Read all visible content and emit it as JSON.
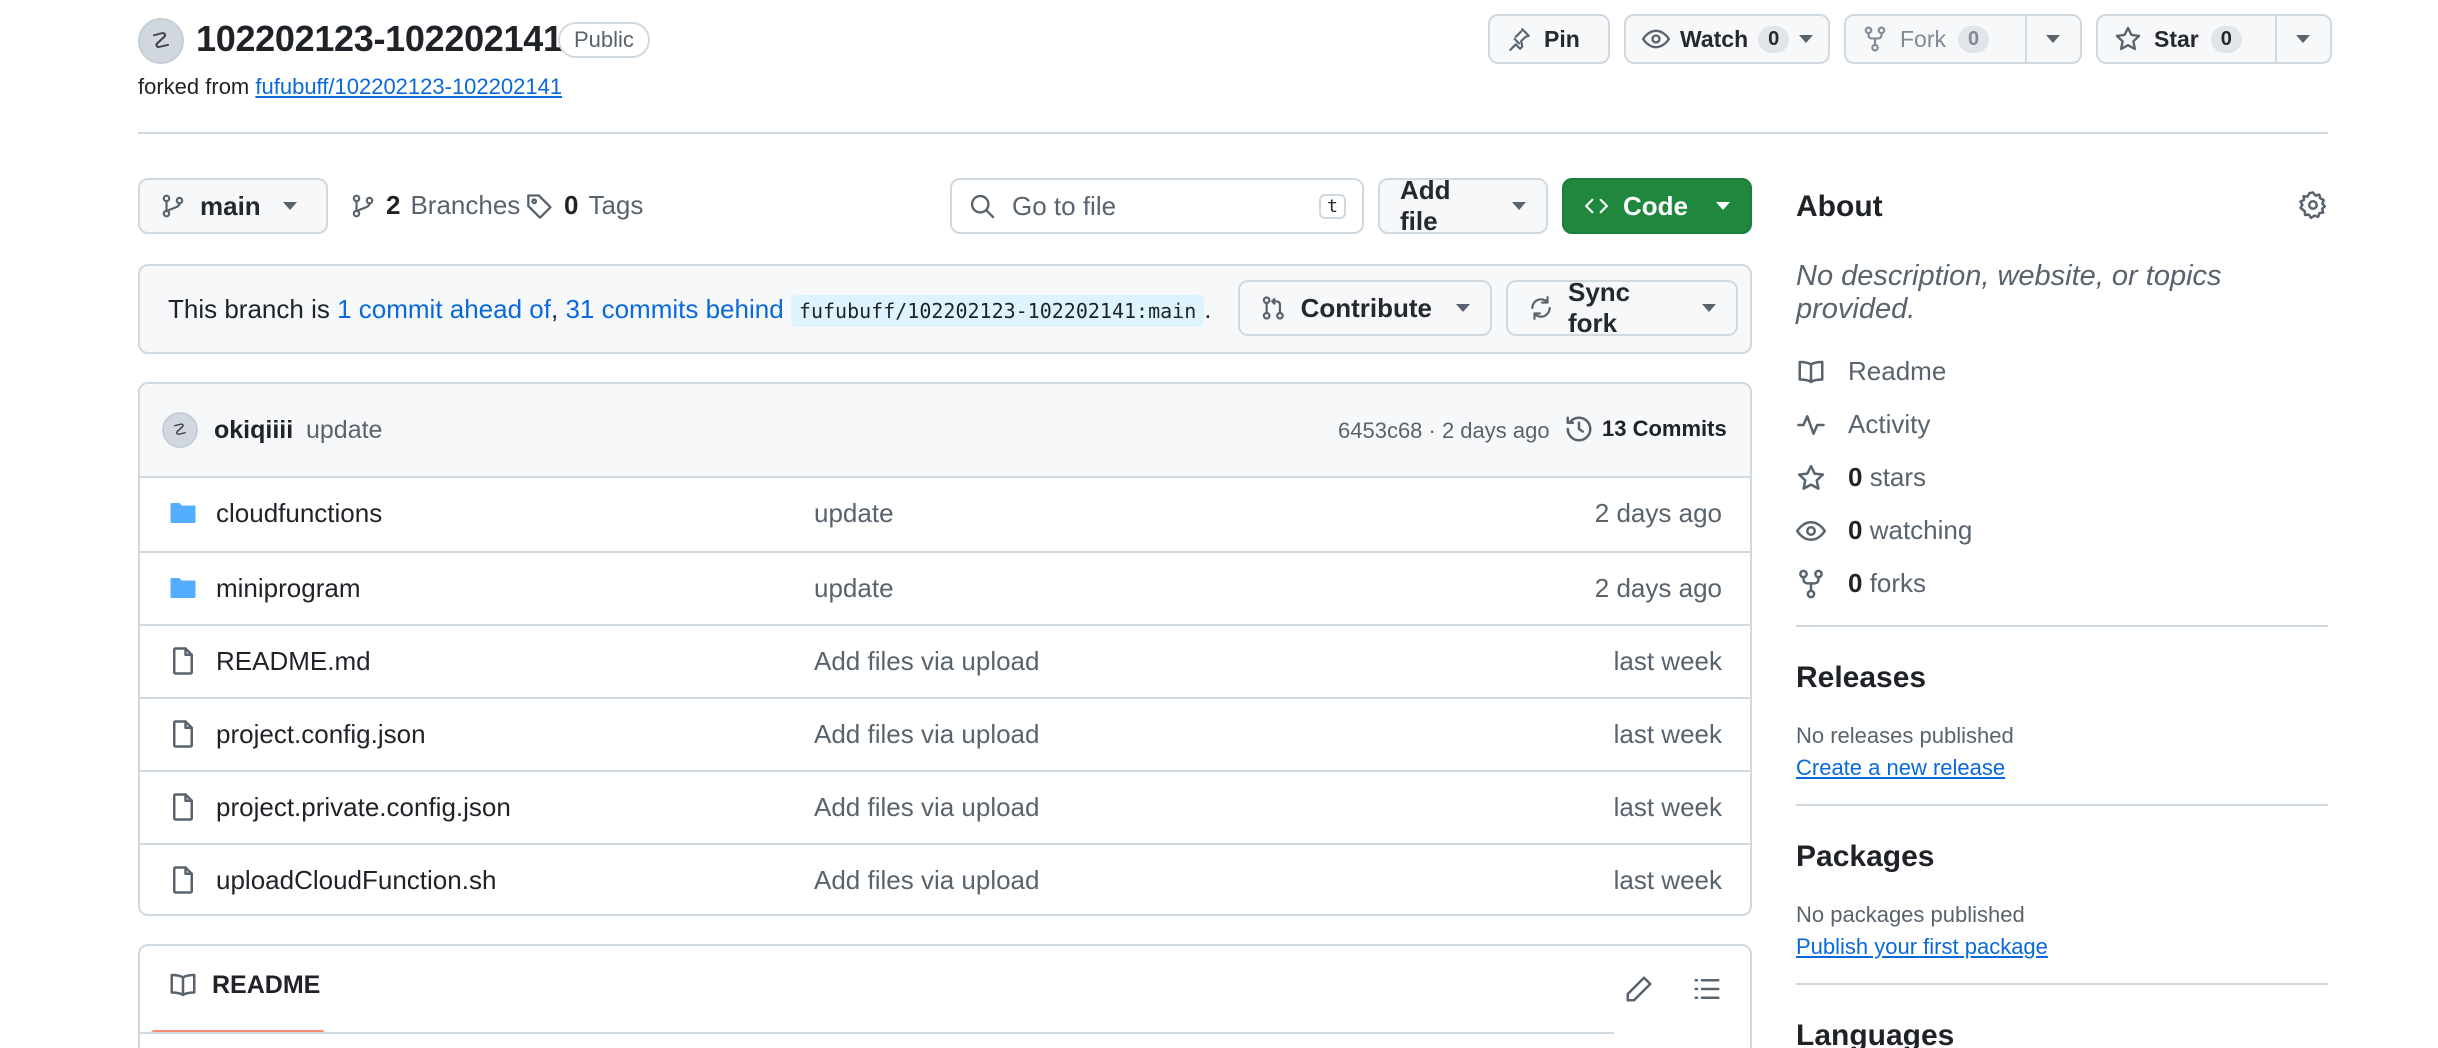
{
  "header": {
    "repo_name": "102202123-102202141",
    "visibility": "Public",
    "forked_prefix": "forked from",
    "forked_from": "fufubuff/102202123-102202141",
    "pin_label": "Pin",
    "watch_label": "Watch",
    "watch_count": "0",
    "fork_label": "Fork",
    "fork_count": "0",
    "star_label": "Star",
    "star_count": "0"
  },
  "toolbar": {
    "branch": "main",
    "branches_count": "2",
    "branches_label": "Branches",
    "tags_count": "0",
    "tags_label": "Tags",
    "search_placeholder": "Go to file",
    "search_shortcut": "t",
    "add_file_label": "Add file",
    "code_label": "Code"
  },
  "banner": {
    "prefix": "This branch is",
    "ahead": "1 commit ahead of",
    "comma": ",",
    "behind": "31 commits behind",
    "ref": "fufubuff/102202123-102202141:main",
    "suffix": ".",
    "contribute_label": "Contribute",
    "sync_label": "Sync fork"
  },
  "latest_commit": {
    "author": "okiqiiii",
    "message": "update",
    "meta": "6453c68 · 2 days ago",
    "commits_label": "13 Commits"
  },
  "files": [
    {
      "type": "folder",
      "name": "cloudfunctions",
      "message": "update",
      "date": "2 days ago"
    },
    {
      "type": "folder",
      "name": "miniprogram",
      "message": "update",
      "date": "2 days ago"
    },
    {
      "type": "file",
      "name": "README.md",
      "message": "Add files via upload",
      "date": "last week"
    },
    {
      "type": "file",
      "name": "project.config.json",
      "message": "Add files via upload",
      "date": "last week"
    },
    {
      "type": "file",
      "name": "project.private.config.json",
      "message": "Add files via upload",
      "date": "last week"
    },
    {
      "type": "file",
      "name": "uploadCloudFunction.sh",
      "message": "Add files via upload",
      "date": "last week"
    }
  ],
  "readme": {
    "tab_label": "README"
  },
  "sidebar": {
    "about_title": "About",
    "description": "No description, website, or topics provided.",
    "readme_label": "Readme",
    "activity_label": "Activity",
    "stars_count": "0",
    "stars_label": "stars",
    "watching_count": "0",
    "watching_label": "watching",
    "forks_count": "0",
    "forks_label": "forks",
    "releases_title": "Releases",
    "releases_empty": "No releases published",
    "releases_link": "Create a new release",
    "packages_title": "Packages",
    "packages_empty": "No packages published",
    "packages_link": "Publish your first package",
    "languages_title": "Languages"
  },
  "colors": {
    "primary_button": "#1f883d",
    "link": "#0969da",
    "folder": "#54aeff",
    "readme_underline": "#fd8c73"
  }
}
